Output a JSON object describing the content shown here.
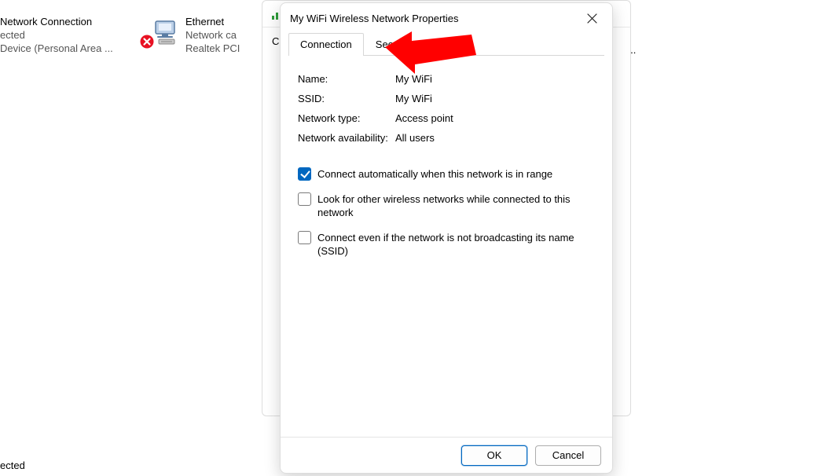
{
  "background": {
    "left_item": {
      "line1": "Network Connection",
      "line2": "ected",
      "line3": "Device (Personal Area ..."
    },
    "ethernet": {
      "line1": "Ethernet",
      "line2": "Network ca",
      "line3": "Realtek PCI"
    },
    "truncated_right": "ir...",
    "back_window_char": "C",
    "status_text": "ected"
  },
  "dialog": {
    "title": "My WiFi Wireless Network Properties",
    "tabs": {
      "connection": "Connection",
      "security": "Security"
    },
    "labels": {
      "name": "Name:",
      "ssid": "SSID:",
      "type": "Network type:",
      "avail": "Network availability:"
    },
    "values": {
      "name": "My WiFi",
      "ssid": "My WiFi",
      "type": "Access point",
      "avail": "All users"
    },
    "checkboxes": {
      "c1": "Connect automatically when this network is in range",
      "c2": "Look for other wireless networks while connected to this network",
      "c3": "Connect even if the network is not broadcasting its name (SSID)"
    },
    "buttons": {
      "ok": "OK",
      "cancel": "Cancel"
    }
  }
}
